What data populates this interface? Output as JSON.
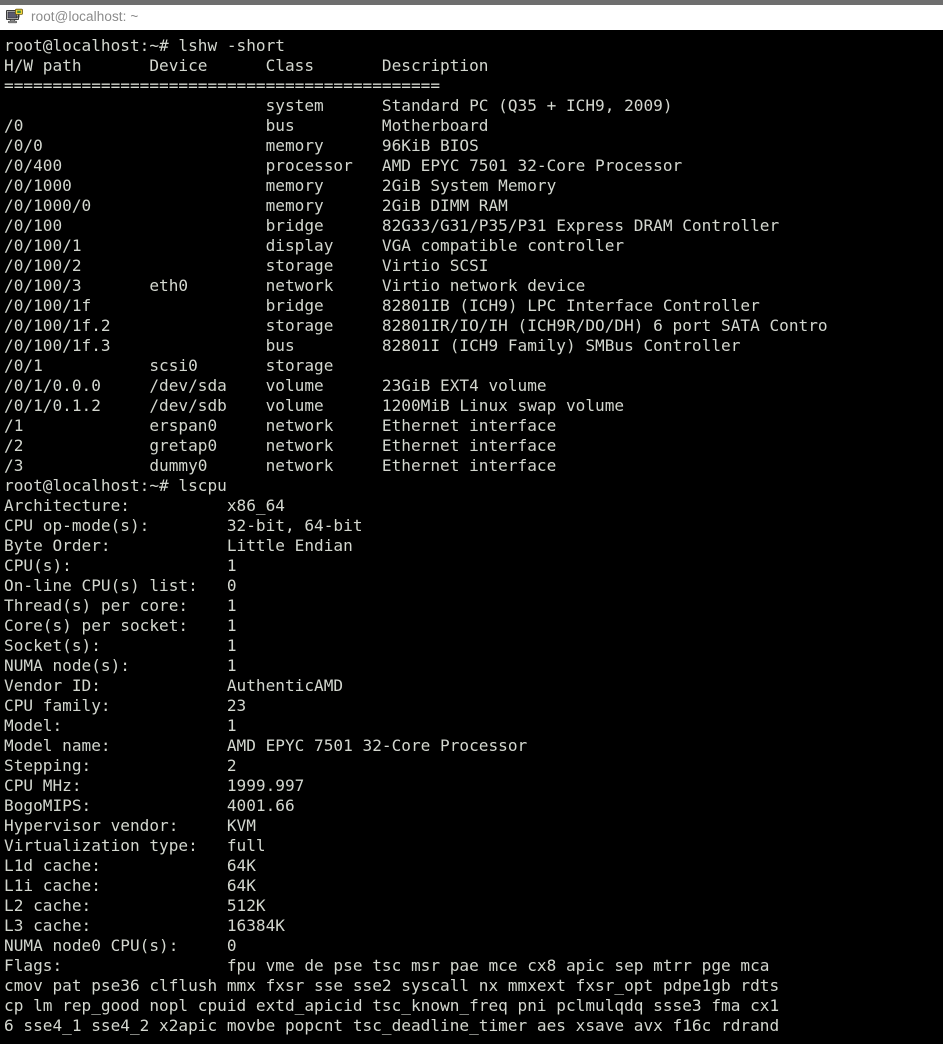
{
  "window": {
    "title": "root@localhost: ~",
    "icon": "putty-computer-icon",
    "titlebar_bg": "#ffffff",
    "titlebar_text_color": "#8b8b8b",
    "terminal_bg": "#000000",
    "terminal_fg": "#d3d7cf"
  },
  "terminal": {
    "prompt": "root@localhost:~#",
    "commands": [
      "lshw -short",
      "lscpu"
    ],
    "lines": [
      "root@localhost:~# lshw -short",
      "H/W path       Device      Class       Description",
      "=============================================",
      "                           system      Standard PC (Q35 + ICH9, 2009)",
      "/0                         bus         Motherboard",
      "/0/0                       memory      96KiB BIOS",
      "/0/400                     processor   AMD EPYC 7501 32-Core Processor",
      "/0/1000                    memory      2GiB System Memory",
      "/0/1000/0                  memory      2GiB DIMM RAM",
      "/0/100                     bridge      82G33/G31/P35/P31 Express DRAM Controller",
      "/0/100/1                   display     VGA compatible controller",
      "/0/100/2                   storage     Virtio SCSI",
      "/0/100/3       eth0        network     Virtio network device",
      "/0/100/1f                  bridge      82801IB (ICH9) LPC Interface Controller",
      "/0/100/1f.2                storage     82801IR/IO/IH (ICH9R/DO/DH) 6 port SATA Contro",
      "/0/100/1f.3                bus         82801I (ICH9 Family) SMBus Controller",
      "/0/1           scsi0       storage",
      "/0/1/0.0.0     /dev/sda    volume      23GiB EXT4 volume",
      "/0/1/0.1.2     /dev/sdb    volume      1200MiB Linux swap volume",
      "/1             erspan0     network     Ethernet interface",
      "/2             gretap0     network     Ethernet interface",
      "/3             dummy0      network     Ethernet interface",
      "root@localhost:~# lscpu",
      "Architecture:          x86_64",
      "CPU op-mode(s):        32-bit, 64-bit",
      "Byte Order:            Little Endian",
      "CPU(s):                1",
      "On-line CPU(s) list:   0",
      "Thread(s) per core:    1",
      "Core(s) per socket:    1",
      "Socket(s):             1",
      "NUMA node(s):          1",
      "Vendor ID:             AuthenticAMD",
      "CPU family:            23",
      "Model:                 1",
      "Model name:            AMD EPYC 7501 32-Core Processor",
      "Stepping:              2",
      "CPU MHz:               1999.997",
      "BogoMIPS:              4001.66",
      "Hypervisor vendor:     KVM",
      "Virtualization type:   full",
      "L1d cache:             64K",
      "L1i cache:             64K",
      "L2 cache:              512K",
      "L3 cache:              16384K",
      "NUMA node0 CPU(s):     0",
      "Flags:                 fpu vme de pse tsc msr pae mce cx8 apic sep mtrr pge mca",
      "cmov pat pse36 clflush mmx fxsr sse sse2 syscall nx mmxext fxsr_opt pdpe1gb rdts",
      "cp lm rep_good nopl cpuid extd_apicid tsc_known_freq pni pclmulqdq ssse3 fma cx1",
      "6 sse4_1 sse4_2 x2apic movbe popcnt tsc_deadline_timer aes xsave avx f16c rdrand"
    ],
    "lshw_table": {
      "headers": [
        "H/W path",
        "Device",
        "Class",
        "Description"
      ],
      "rows": [
        {
          "path": "",
          "device": "",
          "class": "system",
          "description": "Standard PC (Q35 + ICH9, 2009)"
        },
        {
          "path": "/0",
          "device": "",
          "class": "bus",
          "description": "Motherboard"
        },
        {
          "path": "/0/0",
          "device": "",
          "class": "memory",
          "description": "96KiB BIOS"
        },
        {
          "path": "/0/400",
          "device": "",
          "class": "processor",
          "description": "AMD EPYC 7501 32-Core Processor"
        },
        {
          "path": "/0/1000",
          "device": "",
          "class": "memory",
          "description": "2GiB System Memory"
        },
        {
          "path": "/0/1000/0",
          "device": "",
          "class": "memory",
          "description": "2GiB DIMM RAM"
        },
        {
          "path": "/0/100",
          "device": "",
          "class": "bridge",
          "description": "82G33/G31/P35/P31 Express DRAM Controller"
        },
        {
          "path": "/0/100/1",
          "device": "",
          "class": "display",
          "description": "VGA compatible controller"
        },
        {
          "path": "/0/100/2",
          "device": "",
          "class": "storage",
          "description": "Virtio SCSI"
        },
        {
          "path": "/0/100/3",
          "device": "eth0",
          "class": "network",
          "description": "Virtio network device"
        },
        {
          "path": "/0/100/1f",
          "device": "",
          "class": "bridge",
          "description": "82801IB (ICH9) LPC Interface Controller"
        },
        {
          "path": "/0/100/1f.2",
          "device": "",
          "class": "storage",
          "description": "82801IR/IO/IH (ICH9R/DO/DH) 6 port SATA Contro"
        },
        {
          "path": "/0/100/1f.3",
          "device": "",
          "class": "bus",
          "description": "82801I (ICH9 Family) SMBus Controller"
        },
        {
          "path": "/0/1",
          "device": "scsi0",
          "class": "storage",
          "description": ""
        },
        {
          "path": "/0/1/0.0.0",
          "device": "/dev/sda",
          "class": "volume",
          "description": "23GiB EXT4 volume"
        },
        {
          "path": "/0/1/0.1.2",
          "device": "/dev/sdb",
          "class": "volume",
          "description": "1200MiB Linux swap volume"
        },
        {
          "path": "/1",
          "device": "erspan0",
          "class": "network",
          "description": "Ethernet interface"
        },
        {
          "path": "/2",
          "device": "gretap0",
          "class": "network",
          "description": "Ethernet interface"
        },
        {
          "path": "/3",
          "device": "dummy0",
          "class": "network",
          "description": "Ethernet interface"
        }
      ]
    },
    "lscpu_fields": [
      {
        "label": "Architecture:",
        "value": "x86_64"
      },
      {
        "label": "CPU op-mode(s):",
        "value": "32-bit, 64-bit"
      },
      {
        "label": "Byte Order:",
        "value": "Little Endian"
      },
      {
        "label": "CPU(s):",
        "value": "1"
      },
      {
        "label": "On-line CPU(s) list:",
        "value": "0"
      },
      {
        "label": "Thread(s) per core:",
        "value": "1"
      },
      {
        "label": "Core(s) per socket:",
        "value": "1"
      },
      {
        "label": "Socket(s):",
        "value": "1"
      },
      {
        "label": "NUMA node(s):",
        "value": "1"
      },
      {
        "label": "Vendor ID:",
        "value": "AuthenticAMD"
      },
      {
        "label": "CPU family:",
        "value": "23"
      },
      {
        "label": "Model:",
        "value": "1"
      },
      {
        "label": "Model name:",
        "value": "AMD EPYC 7501 32-Core Processor"
      },
      {
        "label": "Stepping:",
        "value": "2"
      },
      {
        "label": "CPU MHz:",
        "value": "1999.997"
      },
      {
        "label": "BogoMIPS:",
        "value": "4001.66"
      },
      {
        "label": "Hypervisor vendor:",
        "value": "KVM"
      },
      {
        "label": "Virtualization type:",
        "value": "full"
      },
      {
        "label": "L1d cache:",
        "value": "64K"
      },
      {
        "label": "L1i cache:",
        "value": "64K"
      },
      {
        "label": "L2 cache:",
        "value": "512K"
      },
      {
        "label": "L3 cache:",
        "value": "16384K"
      },
      {
        "label": "NUMA node0 CPU(s):",
        "value": "0"
      },
      {
        "label": "Flags:",
        "value": "fpu vme de pse tsc msr pae mce cx8 apic sep mtrr pge mca cmov pat pse36 clflush mmx fxsr sse sse2 syscall nx mmxext fxsr_opt pdpe1gb rdtscp lm rep_good nopl cpuid extd_apicid tsc_known_freq pni pclmulqdq ssse3 fma cx16 sse4_1 sse4_2 x2apic movbe popcnt tsc_deadline_timer aes xsave avx f16c rdrand"
      }
    ]
  }
}
